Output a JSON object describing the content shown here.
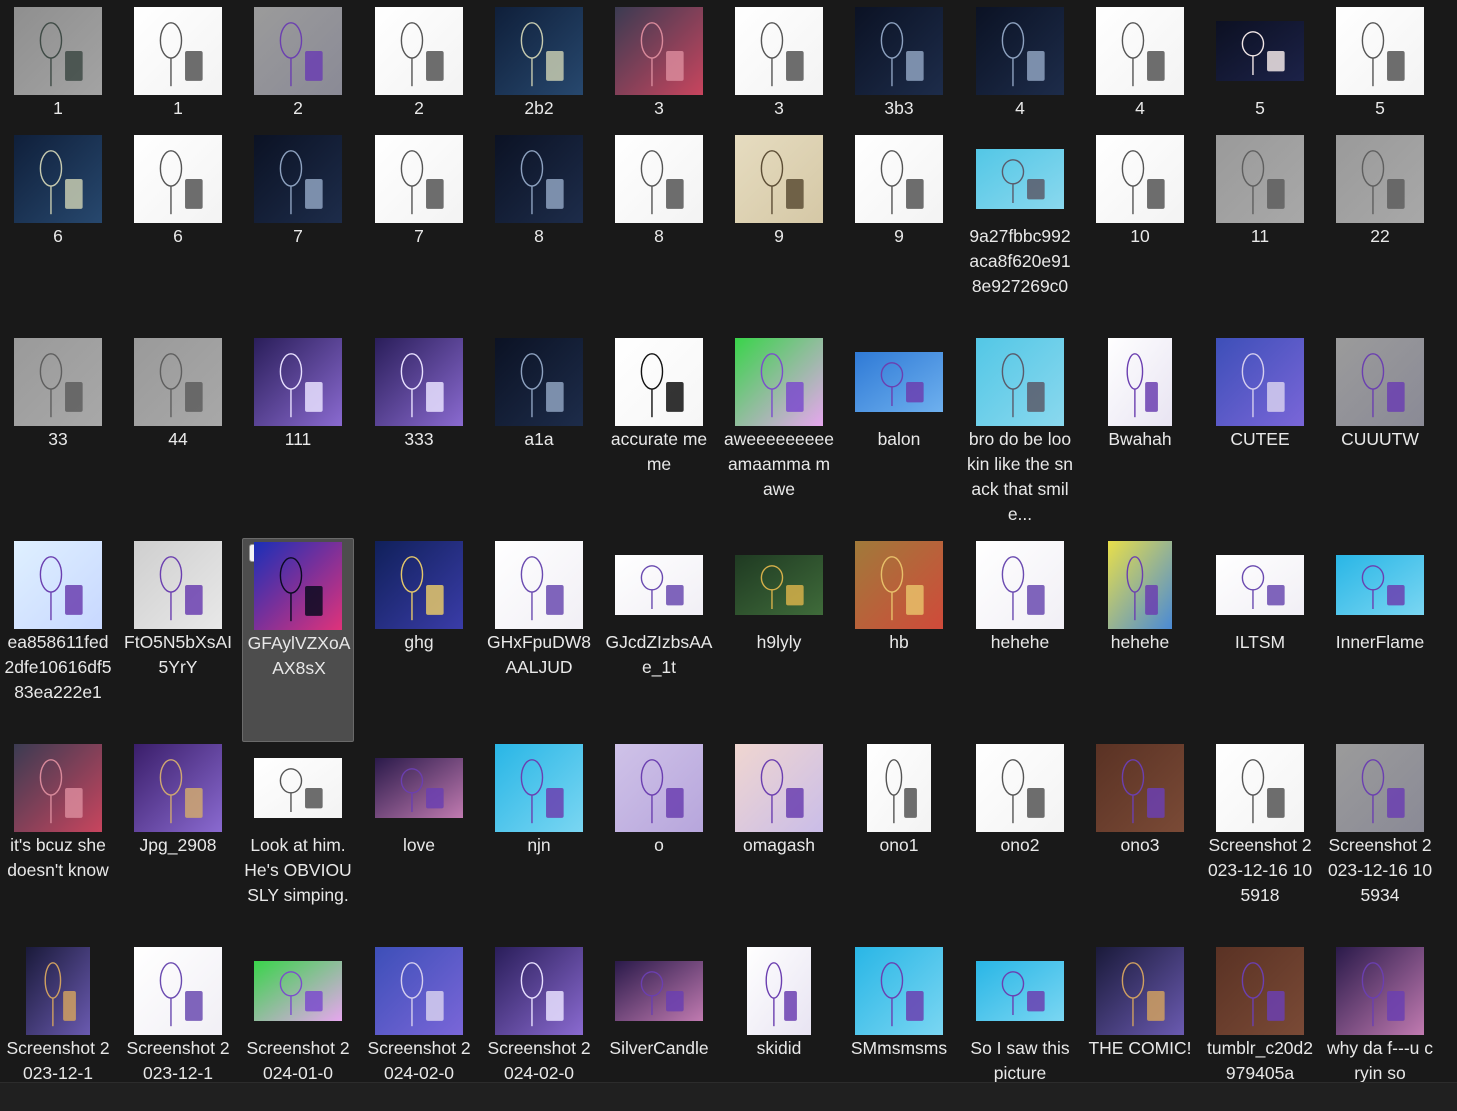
{
  "window": {
    "view": "large-icons",
    "selected_file": "GFAylVZXoAAX8sX"
  },
  "files": [
    [
      {
        "label": "1",
        "kind": "gray-face",
        "shape": "square"
      },
      {
        "label": "1",
        "kind": "sketch-white",
        "shape": "square"
      },
      {
        "label": "2",
        "kind": "candle-gray",
        "shape": "square"
      },
      {
        "label": "2",
        "kind": "sketch-white",
        "shape": "square"
      },
      {
        "label": "2b2",
        "kind": "dark-blue",
        "shape": "square"
      },
      {
        "label": "3",
        "kind": "pink-collage",
        "shape": "square"
      },
      {
        "label": "3",
        "kind": "sketch-white",
        "shape": "square"
      },
      {
        "label": "3b3",
        "kind": "dark-navy",
        "shape": "square"
      },
      {
        "label": "4",
        "kind": "dark-navy",
        "shape": "square"
      },
      {
        "label": "4",
        "kind": "sketch-white",
        "shape": "square"
      },
      {
        "label": "5",
        "kind": "night-moon",
        "shape": "wide"
      },
      {
        "label": "5",
        "kind": "sketch-white",
        "shape": "square"
      }
    ],
    [
      {
        "label": "6",
        "kind": "dark-blue",
        "shape": "square"
      },
      {
        "label": "6",
        "kind": "sketch-white",
        "shape": "square"
      },
      {
        "label": "7",
        "kind": "dark-navy",
        "shape": "square"
      },
      {
        "label": "7",
        "kind": "sketch-white",
        "shape": "square"
      },
      {
        "label": "8",
        "kind": "dark-navy",
        "shape": "square"
      },
      {
        "label": "8",
        "kind": "sketch-white",
        "shape": "square"
      },
      {
        "label": "9",
        "kind": "paper-beige",
        "shape": "square"
      },
      {
        "label": "9",
        "kind": "sketch-white",
        "shape": "square"
      },
      {
        "label": "9a27fbbc992aca8f620e918e927269c0",
        "kind": "cyan-chars",
        "shape": "wide"
      },
      {
        "label": "10",
        "kind": "sketch-white",
        "shape": "square"
      },
      {
        "label": "11",
        "kind": "sketch-gray",
        "shape": "square"
      },
      {
        "label": "22",
        "kind": "sketch-gray",
        "shape": "square"
      }
    ],
    [
      {
        "label": "33",
        "kind": "sketch-gray",
        "shape": "square"
      },
      {
        "label": "44",
        "kind": "sketch-gray",
        "shape": "square"
      },
      {
        "label": "111",
        "kind": "purple-hug",
        "shape": "square"
      },
      {
        "label": "333",
        "kind": "purple-hug",
        "shape": "square"
      },
      {
        "label": "a1a",
        "kind": "dark-navy",
        "shape": "square"
      },
      {
        "label": "accurate meme",
        "kind": "meme-white",
        "shape": "square"
      },
      {
        "label": "aweeeeeeeee amaamma mawe",
        "kind": "green-hearts",
        "shape": "square"
      },
      {
        "label": "balon",
        "kind": "blue-candle",
        "shape": "wide"
      },
      {
        "label": "bro do be lookin like the snack that smile...",
        "kind": "cyan-chars",
        "shape": "square"
      },
      {
        "label": "Bwahah",
        "kind": "white-purple",
        "shape": "tall"
      },
      {
        "label": "CUTEE",
        "kind": "blue-purple",
        "shape": "square"
      },
      {
        "label": "CUUUTW",
        "kind": "candle-gray",
        "shape": "square"
      }
    ],
    [
      {
        "label": "ea858611fed2dfe10616df583ea222e1",
        "kind": "light-blue",
        "shape": "square"
      },
      {
        "label": "FtO5N5bXsAI5YrY",
        "kind": "two-lovers",
        "shape": "square"
      },
      {
        "label": "GFAylVZXoAAX8sX",
        "kind": "red-blue",
        "shape": "square"
      },
      {
        "label": "ghg",
        "kind": "starry",
        "shape": "square"
      },
      {
        "label": "GHxFpuDW8AALJUD",
        "kind": "sketch-color",
        "shape": "square"
      },
      {
        "label": "GJcdZIzbsAAe_1t",
        "kind": "sketch-color",
        "shape": "wide"
      },
      {
        "label": "h9lyly",
        "kind": "forest",
        "shape": "wide"
      },
      {
        "label": "hb",
        "kind": "orange-red",
        "shape": "square"
      },
      {
        "label": "hehehe",
        "kind": "sketch-color",
        "shape": "square"
      },
      {
        "label": "hehehe",
        "kind": "yellow-poster",
        "shape": "tall"
      },
      {
        "label": "ILTSM",
        "kind": "sketch-color",
        "shape": "wide"
      },
      {
        "label": "InnerFlame",
        "kind": "sky-candle",
        "shape": "wide"
      }
    ],
    [
      {
        "label": "it's bcuz she doesn't know",
        "kind": "pink-collage",
        "shape": "square"
      },
      {
        "label": "Jpg_2908",
        "kind": "purple-boat",
        "shape": "square"
      },
      {
        "label": "Look at him. He's OBVIOUSLY simping.",
        "kind": "sketch-white",
        "shape": "wide"
      },
      {
        "label": "love",
        "kind": "purple-sunset",
        "shape": "wide"
      },
      {
        "label": "njn",
        "kind": "sky-candle",
        "shape": "square"
      },
      {
        "label": "o",
        "kind": "lavender",
        "shape": "square"
      },
      {
        "label": "omagash",
        "kind": "pastel",
        "shape": "square"
      },
      {
        "label": "ono1",
        "kind": "sketch-white",
        "shape": "tall"
      },
      {
        "label": "ono2",
        "kind": "sketch-white",
        "shape": "square"
      },
      {
        "label": "ono3",
        "kind": "brown-room",
        "shape": "square"
      },
      {
        "label": "Screenshot 2023-12-16 105918",
        "kind": "sketch-white",
        "shape": "square"
      },
      {
        "label": "Screenshot 2023-12-16 105934",
        "kind": "candle-gray",
        "shape": "square"
      }
    ],
    [
      {
        "label": "Screenshot 2023-12-1",
        "kind": "comic-strip",
        "shape": "tall"
      },
      {
        "label": "Screenshot 2023-12-1",
        "kind": "sketch-color",
        "shape": "square"
      },
      {
        "label": "Screenshot 2024-01-0",
        "kind": "green-hearts",
        "shape": "wide"
      },
      {
        "label": "Screenshot 2024-02-0",
        "kind": "blue-purple",
        "shape": "square"
      },
      {
        "label": "Screenshot 2024-02-0",
        "kind": "purple-hug",
        "shape": "square"
      },
      {
        "label": "SilverCandle",
        "kind": "purple-sunset",
        "shape": "wide"
      },
      {
        "label": "skidid",
        "kind": "white-purple",
        "shape": "tall"
      },
      {
        "label": "SMmsmsms",
        "kind": "sky-candle",
        "shape": "square"
      },
      {
        "label": "So I saw this picture",
        "kind": "sky-candle",
        "shape": "wide"
      },
      {
        "label": "THE COMIC!",
        "kind": "comic-strip",
        "shape": "square"
      },
      {
        "label": "tumblr_c20d2979405a",
        "kind": "brown-room",
        "shape": "square"
      },
      {
        "label": "why da f---u cryin so",
        "kind": "purple-sunset",
        "shape": "square"
      }
    ]
  ],
  "palette": {
    "background": "#191919",
    "selection": "#4d4d4d",
    "caption_text": "#e8e8e8",
    "thumbs": {
      "gray-face": [
        "#8f8f8f",
        "#a3a3a3",
        "#3e4a45"
      ],
      "sketch-white": [
        "#ffffff",
        "#f3f3f3",
        "#555555"
      ],
      "sketch-gray": [
        "#9a9a9a",
        "#a8a8a8",
        "#5e5e5e"
      ],
      "sketch-color": [
        "#ffffff",
        "#f1eff5",
        "#6a4ab0"
      ],
      "candle-gray": [
        "#9b9b9b",
        "#8a8a96",
        "#6b3fb0"
      ],
      "dark-blue": [
        "#0f1f3a",
        "#27486e",
        "#c7cbb0"
      ],
      "dark-navy": [
        "#0b1224",
        "#1d2c4a",
        "#8ea2c0"
      ],
      "pink-collage": [
        "#3b3b52",
        "#c8455e",
        "#d98a9b"
      ],
      "night-moon": [
        "#0c1022",
        "#1c2248",
        "#f1e6e6"
      ],
      "paper-beige": [
        "#e6dcc0",
        "#d5c8a6",
        "#5c4d35"
      ],
      "cyan-chars": [
        "#53c7e6",
        "#8ad8ee",
        "#5a5a6a"
      ],
      "purple-hug": [
        "#2a1e5a",
        "#8a6ad0",
        "#e8e0ff"
      ],
      "meme-white": [
        "#ffffff",
        "#f6f6f6",
        "#111111"
      ],
      "green-hearts": [
        "#39d44a",
        "#e6a6ee",
        "#7b4ccc"
      ],
      "blue-candle": [
        "#2f7ad6",
        "#6eb0ee",
        "#6b3fb0"
      ],
      "white-purple": [
        "#ffffff",
        "#e8e4f2",
        "#6b3fb0"
      ],
      "blue-purple": [
        "#3d4fb8",
        "#7a66d8",
        "#d6cfee"
      ],
      "light-blue": [
        "#dff0ff",
        "#c8d8ff",
        "#6b3fb0"
      ],
      "two-lovers": [
        "#cfcfcf",
        "#e8e8e8",
        "#6b3fb0"
      ],
      "red-blue": [
        "#1a2fb8",
        "#e0327a",
        "#0a0a20"
      ],
      "starry": [
        "#10205a",
        "#3a3ca8",
        "#e5c86a"
      ],
      "forest": [
        "#1f3a22",
        "#3f6b3a",
        "#d6b04a"
      ],
      "orange-red": [
        "#a07a3a",
        "#d04a3a",
        "#e8c06a"
      ],
      "yellow-poster": [
        "#e8df4a",
        "#4a8ad6",
        "#6b3fb0"
      ],
      "sky-candle": [
        "#29b6e6",
        "#7ad6f2",
        "#6b3fb0"
      ],
      "purple-boat": [
        "#3a1e6a",
        "#8a6ad0",
        "#d0a870"
      ],
      "purple-sunset": [
        "#2a1a4a",
        "#c07ab0",
        "#6b3fb0"
      ],
      "lavender": [
        "#cfc2e8",
        "#b7a6dc",
        "#6b3fb0"
      ],
      "pastel": [
        "#f0d6d0",
        "#cabde8",
        "#6b3fb0"
      ],
      "brown-room": [
        "#5a3224",
        "#7a4a36",
        "#6b3fb0"
      ],
      "comic-strip": [
        "#1a1a3a",
        "#6a5ab0",
        "#d0a060"
      ]
    }
  }
}
